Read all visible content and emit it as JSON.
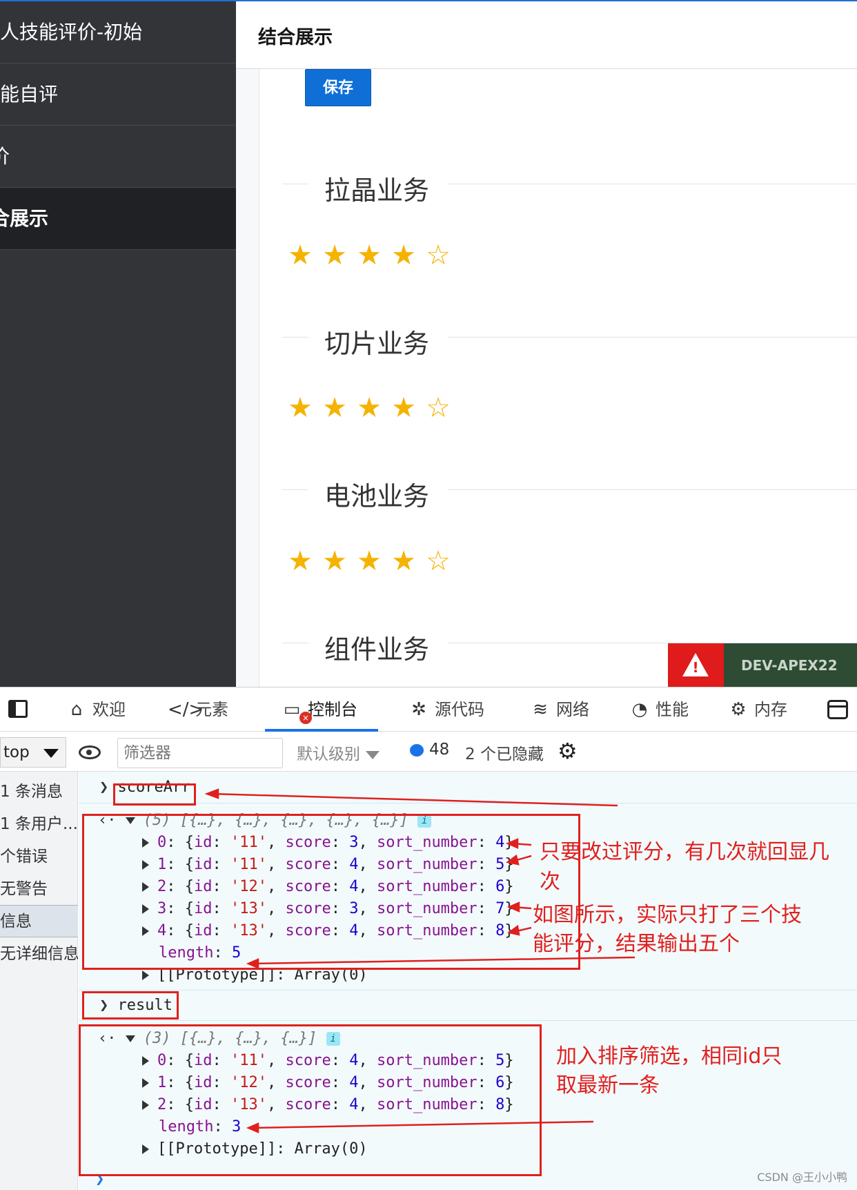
{
  "sidebar": {
    "items": [
      {
        "label": "人技能评价-初始"
      },
      {
        "label": "能自评"
      },
      {
        "label": "价"
      },
      {
        "label": "合展示"
      }
    ]
  },
  "header": {
    "title": "结合展示"
  },
  "toolbar": {
    "save_label": "保存"
  },
  "sections": [
    {
      "title": "拉晶业务",
      "rating": 4,
      "max": 5
    },
    {
      "title": "切片业务",
      "rating": 4,
      "max": 5
    },
    {
      "title": "电池业务",
      "rating": 4,
      "max": 5
    },
    {
      "title": "组件业务"
    }
  ],
  "badge": {
    "label": "DEV-APEX22",
    "icon": "warning-icon"
  },
  "devtools": {
    "tabs": [
      {
        "label": "欢迎",
        "icon": "home-icon"
      },
      {
        "label": "元素",
        "icon": "code-icon"
      },
      {
        "label": "控制台",
        "icon": "console-icon"
      },
      {
        "label": "源代码",
        "icon": "bug-icon"
      },
      {
        "label": "网络",
        "icon": "wifi-icon"
      },
      {
        "label": "性能",
        "icon": "gauge-icon"
      },
      {
        "label": "内存",
        "icon": "chip-icon"
      }
    ],
    "context": "top",
    "filter_placeholder": "筛选器",
    "level": "默认级别",
    "message_count": "48",
    "hidden": "2 个已隐藏",
    "side": [
      "1 条消息",
      "1 条用户...",
      "个错误",
      "无警告",
      "信息",
      "无详细信息"
    ]
  },
  "console": {
    "cmd1": "scoreArr",
    "arr1_summary": "(5) [{…}, {…}, {…}, {…}, {…}]",
    "arr1": [
      {
        "index": "0",
        "id": "'11'",
        "score": "3",
        "sort_number": "4"
      },
      {
        "index": "1",
        "id": "'11'",
        "score": "4",
        "sort_number": "5"
      },
      {
        "index": "2",
        "id": "'12'",
        "score": "4",
        "sort_number": "6"
      },
      {
        "index": "3",
        "id": "'13'",
        "score": "3",
        "sort_number": "7"
      },
      {
        "index": "4",
        "id": "'13'",
        "score": "4",
        "sort_number": "8"
      }
    ],
    "arr1_length": "5",
    "prototype": "[[Prototype]]: Array(0)",
    "cmd2": "result",
    "arr2_summary": "(3) [{…}, {…}, {…}]",
    "arr2": [
      {
        "index": "0",
        "id": "'11'",
        "score": "4",
        "sort_number": "5"
      },
      {
        "index": "1",
        "id": "'12'",
        "score": "4",
        "sort_number": "6"
      },
      {
        "index": "2",
        "id": "'13'",
        "score": "4",
        "sort_number": "8"
      }
    ],
    "arr2_length": "3"
  },
  "annotations": {
    "a1": "只要改过评分，有几次就回显几",
    "a1b": "次",
    "a2": "如图所示，实际只打了三个技",
    "a2b": "能评分，结果输出五个",
    "a3": "加入排序筛选，相同id只",
    "a3b": "取最新一条"
  },
  "watermark": "CSDN @王小小鸭",
  "colors": {
    "accent": "#0f6fd6",
    "star": "#f5b301",
    "annotation": "#e0201e",
    "sidebar": "#323438"
  }
}
